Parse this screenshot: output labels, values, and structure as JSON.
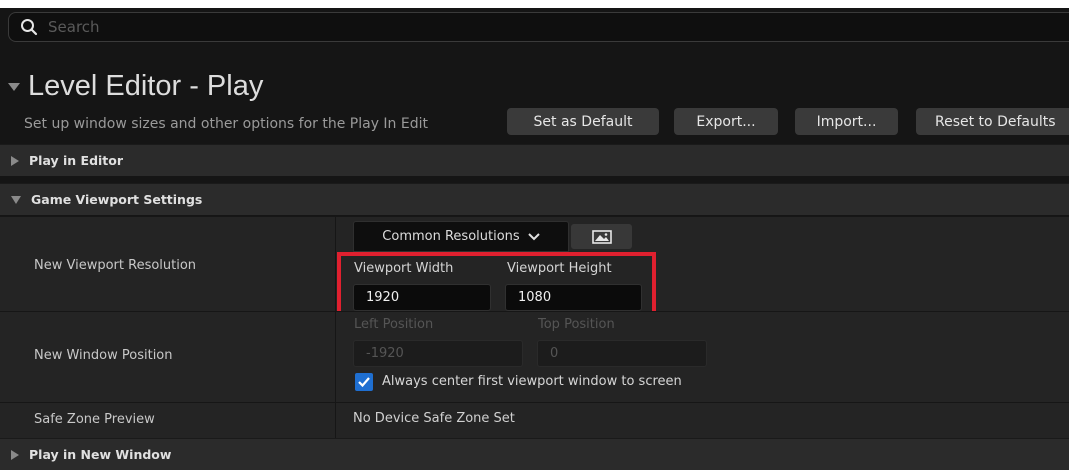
{
  "search": {
    "placeholder": "Search"
  },
  "header": {
    "title": "Level Editor - Play",
    "description": "Set up window sizes and other options for the Play In Edit"
  },
  "buttons": {
    "set_default": "Set as Default",
    "export": "Export...",
    "import": "Import...",
    "reset": "Reset to Defaults"
  },
  "sections": {
    "play_in_editor": "Play in Editor",
    "game_viewport": "Game Viewport Settings",
    "play_in_new_window": "Play in New Window"
  },
  "viewport_resolution": {
    "label": "New Viewport Resolution",
    "dropdown": "Common Resolutions",
    "width_label": "Viewport Width",
    "height_label": "Viewport Height",
    "width_value": "1920",
    "height_value": "1080"
  },
  "window_position": {
    "label": "New Window Position",
    "left_label": "Left Position",
    "top_label": "Top Position",
    "left_value": "-1920",
    "top_value": "0",
    "center_checkbox_label": "Always center first viewport window to screen",
    "center_checked": true
  },
  "safe_zone": {
    "label": "Safe Zone Preview",
    "value": "No Device Safe Zone Set"
  },
  "colors": {
    "highlight": "#e0202f",
    "checkbox": "#1f6fd1"
  }
}
